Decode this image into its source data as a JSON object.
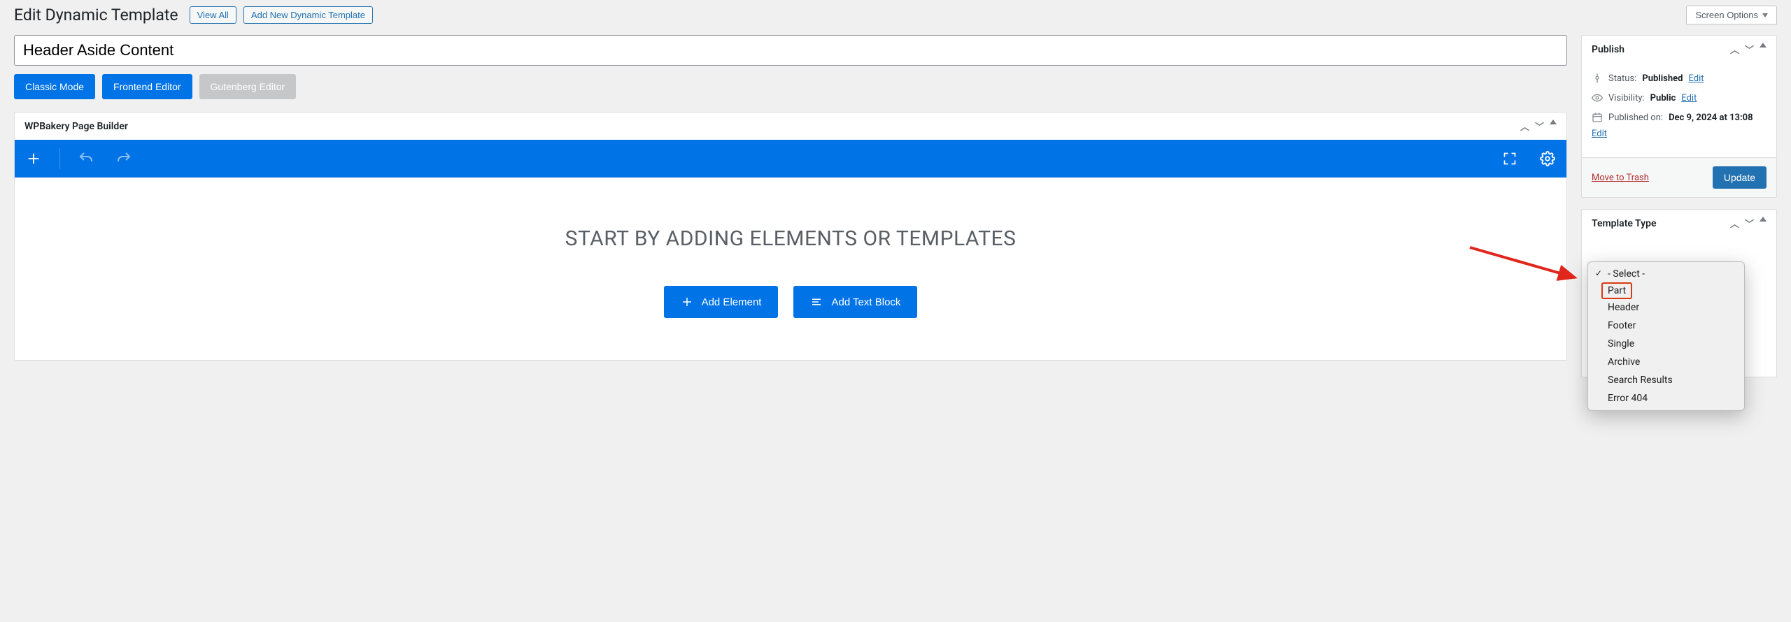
{
  "header": {
    "title": "Edit Dynamic Template",
    "view_all": "View All",
    "add_new": "Add New Dynamic Template",
    "screen_options": "Screen Options"
  },
  "title_input": "Header Aside Content",
  "modes": {
    "classic": "Classic Mode",
    "frontend": "Frontend Editor",
    "gutenberg": "Gutenberg Editor"
  },
  "builder": {
    "panel_title": "WPBakery Page Builder",
    "headline": "START BY ADDING ELEMENTS OR TEMPLATES",
    "add_element": "Add Element",
    "add_text_block": "Add Text Block"
  },
  "publish": {
    "title": "Publish",
    "status_label": "Status:",
    "status_value": "Published",
    "visibility_label": "Visibility:",
    "visibility_value": "Public",
    "published_label": "Published on:",
    "published_value": "Dec 9, 2024 at 13:08",
    "edit": "Edit",
    "trash": "Move to Trash",
    "update": "Update"
  },
  "template_type": {
    "title": "Template Type",
    "options": [
      {
        "label": "- Select -",
        "checked": true,
        "highlight": false
      },
      {
        "label": "Part",
        "checked": false,
        "highlight": true
      },
      {
        "label": "Header",
        "checked": false,
        "highlight": false
      },
      {
        "label": "Footer",
        "checked": false,
        "highlight": false
      },
      {
        "label": "Single",
        "checked": false,
        "highlight": false
      },
      {
        "label": "Archive",
        "checked": false,
        "highlight": false
      },
      {
        "label": "Search Results",
        "checked": false,
        "highlight": false
      },
      {
        "label": "Error 404",
        "checked": false,
        "highlight": false
      }
    ]
  }
}
